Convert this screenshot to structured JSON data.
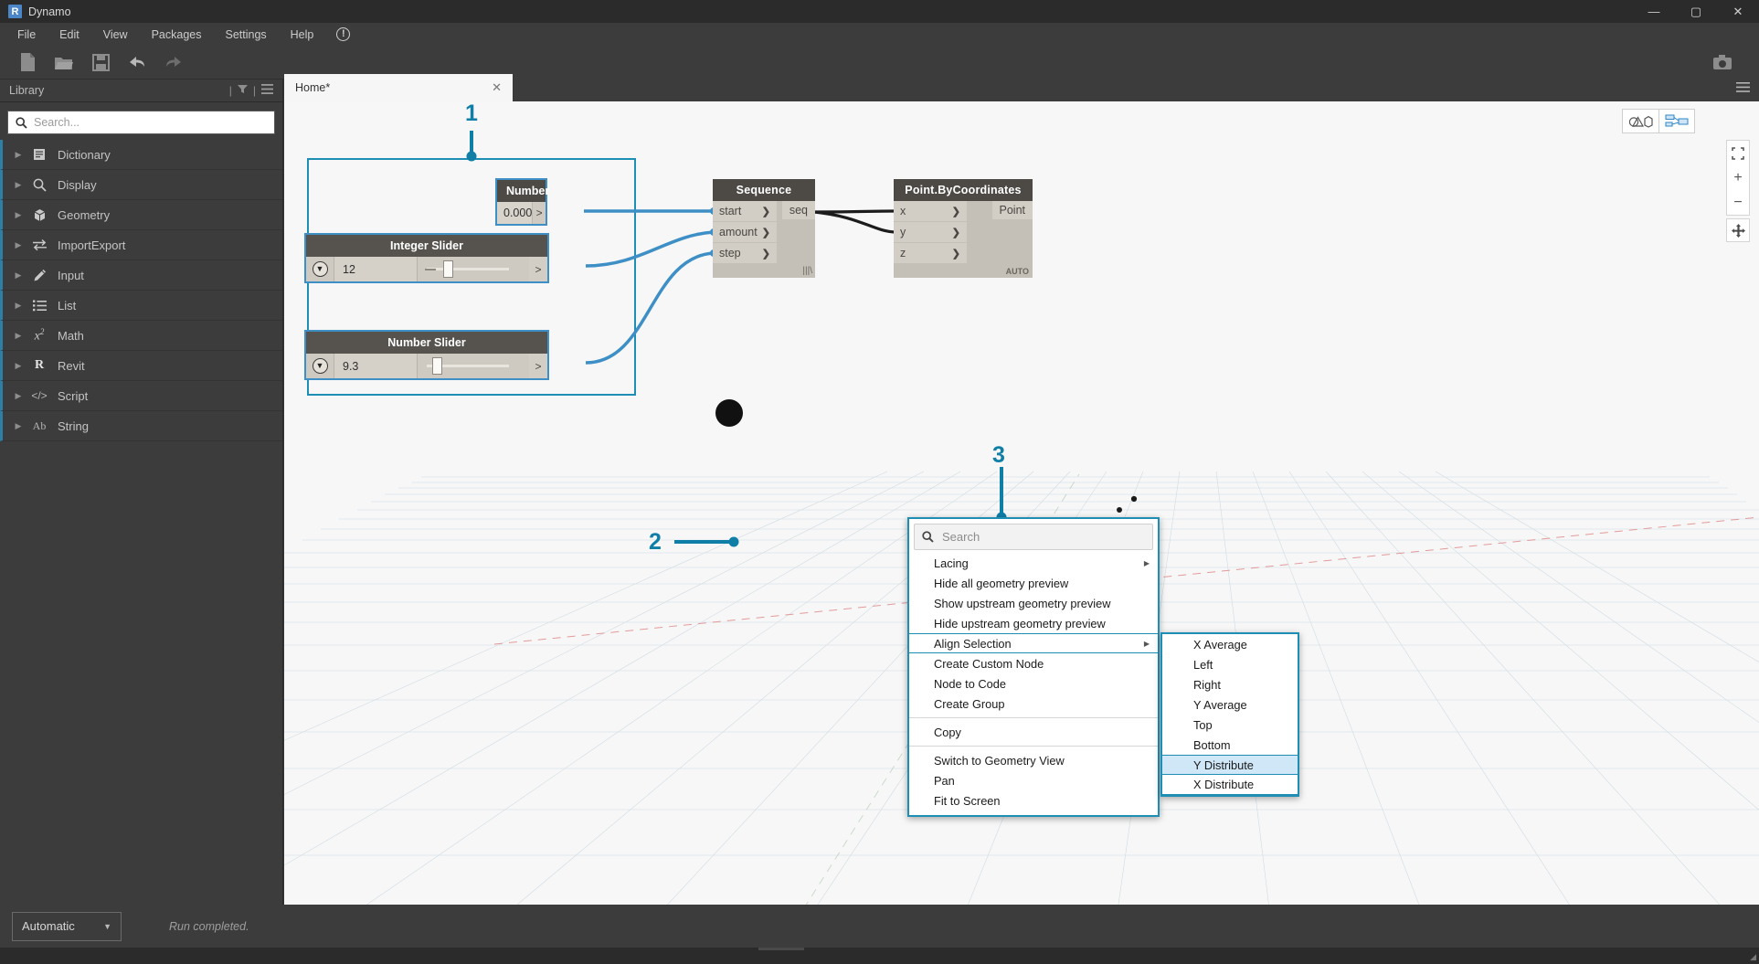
{
  "window": {
    "title": "Dynamo",
    "logo_letter": "R",
    "minimize": "—",
    "maximize": "▢",
    "close": "✕"
  },
  "menubar": {
    "items": [
      {
        "label": "File"
      },
      {
        "label": "Edit"
      },
      {
        "label": "View"
      },
      {
        "label": "Packages"
      },
      {
        "label": "Settings"
      },
      {
        "label": "Help"
      }
    ],
    "info_icon": "!"
  },
  "toolbar": {
    "buttons": [
      {
        "name": "new-file-icon"
      },
      {
        "name": "open-file-icon"
      },
      {
        "name": "save-file-icon"
      },
      {
        "name": "undo-icon"
      },
      {
        "name": "redo-icon"
      }
    ],
    "screenshot_icon": "camera-icon"
  },
  "library": {
    "header_title": "Library",
    "search_placeholder": "Search...",
    "search_value": "",
    "items": [
      {
        "label": "Dictionary",
        "icon": "book-icon"
      },
      {
        "label": "Display",
        "icon": "magnifier-icon"
      },
      {
        "label": "Geometry",
        "icon": "cube-icon"
      },
      {
        "label": "ImportExport",
        "icon": "exchange-arrows-icon"
      },
      {
        "label": "Input",
        "icon": "pencil-icon"
      },
      {
        "label": "List",
        "icon": "list-icon"
      },
      {
        "label": "Math",
        "icon": "x-squared-icon"
      },
      {
        "label": "Revit",
        "icon": "revit-r-icon"
      },
      {
        "label": "Script",
        "icon": "code-tags-icon"
      },
      {
        "label": "String",
        "icon": "ab-text-icon"
      }
    ]
  },
  "workspace": {
    "tab_label": "Home*",
    "tab_close": "✕"
  },
  "graph": {
    "number_node": {
      "title": "Number",
      "value": "0.000",
      "output_caret": ">"
    },
    "integer_slider": {
      "title": "Integer Slider",
      "value": "12",
      "output_caret": ">",
      "thumb_percent": 18
    },
    "number_slider": {
      "title": "Number Slider",
      "value": "9.3",
      "output_caret": ">",
      "thumb_percent": 14
    },
    "sequence_node": {
      "title": "Sequence",
      "inputs": [
        "start",
        "amount",
        "step"
      ],
      "output": "seq",
      "lacing_mark": "|||\\"
    },
    "point_node": {
      "title": "Point.ByCoordinates",
      "inputs": [
        "x",
        "y",
        "z"
      ],
      "output": "Point",
      "badge": "AUTO"
    }
  },
  "context_menu": {
    "search_placeholder": "Search",
    "search_value": "",
    "items": [
      {
        "label": "Lacing",
        "submenu": true
      },
      {
        "label": "Hide all geometry preview",
        "submenu": false
      },
      {
        "label": "Show upstream geometry preview",
        "submenu": false
      },
      {
        "label": "Hide upstream geometry preview",
        "submenu": false
      },
      {
        "label": "Align Selection",
        "submenu": true,
        "highlighted": true
      },
      {
        "label": "Create Custom Node",
        "submenu": false
      },
      {
        "label": "Node to Code",
        "submenu": false
      },
      {
        "label": "Create Group",
        "submenu": false
      },
      {
        "label": "Copy",
        "submenu": false
      },
      {
        "label": "Switch to Geometry View",
        "submenu": false
      },
      {
        "label": "Pan",
        "submenu": false
      },
      {
        "label": "Fit to Screen",
        "submenu": false
      }
    ]
  },
  "align_submenu": {
    "items": [
      {
        "label": "X Average",
        "selected": false
      },
      {
        "label": "Left",
        "selected": false
      },
      {
        "label": "Right",
        "selected": false
      },
      {
        "label": "Y Average",
        "selected": false
      },
      {
        "label": "Top",
        "selected": false
      },
      {
        "label": "Bottom",
        "selected": false
      },
      {
        "label": "Y Distribute",
        "selected": true
      },
      {
        "label": "X Distribute",
        "selected": false
      }
    ]
  },
  "annotations": {
    "marker_1": "1",
    "marker_2": "2",
    "marker_3": "3",
    "accent_color": "#0f7fa8"
  },
  "view_controls": {
    "geometry_view_icon": "geometry-shapes-icon",
    "graph_view_icon": "node-graph-icon",
    "fit_icon": "fit-to-screen-icon",
    "zoom_in": "+",
    "zoom_out": "−",
    "pan_icon": "pan-move-icon"
  },
  "statusbar": {
    "run_mode": "Automatic",
    "run_chevron": "▼",
    "run_status": "Run completed."
  }
}
